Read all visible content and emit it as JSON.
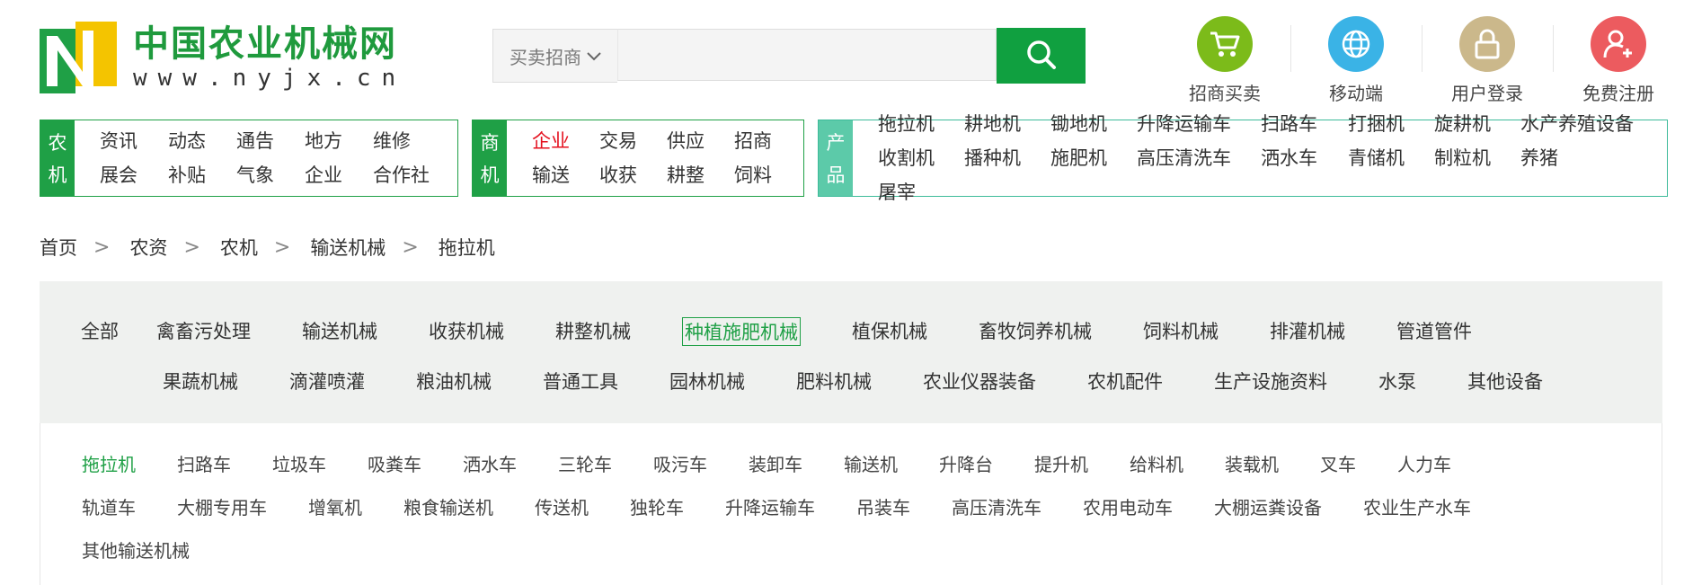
{
  "logo": {
    "name": "中国农业机械网",
    "url": "www.nyjx.cn"
  },
  "search": {
    "category": "买卖招商",
    "value": "",
    "placeholder": ""
  },
  "shortcuts": [
    {
      "label": "招商买卖",
      "color": "#7cbb1a",
      "icon": "cart-icon"
    },
    {
      "label": "移动端",
      "color": "#3ab3e6",
      "icon": "globe-icon"
    },
    {
      "label": "用户登录",
      "color": "#cbb88b",
      "icon": "lock-icon"
    },
    {
      "label": "免费注册",
      "color": "#ec5b5f",
      "icon": "add-user-icon"
    }
  ],
  "nav": {
    "nongji": {
      "tag": [
        "农",
        "机"
      ],
      "items": [
        "资讯",
        "动态",
        "通告",
        "地方",
        "维修",
        "展会",
        "补贴",
        "气象",
        "企业",
        "合作社"
      ]
    },
    "shangji": {
      "tag": [
        "商",
        "机"
      ],
      "items": [
        "企业",
        "交易",
        "供应",
        "招商",
        "输送",
        "收获",
        "耕整",
        "饲料"
      ]
    },
    "chanpin": {
      "tag": [
        "产",
        "品"
      ],
      "items": [
        "拖拉机",
        "耕地机",
        "锄地机",
        "升降运输车",
        "扫路车",
        "打捆机",
        "旋耕机",
        "水产养殖设备",
        "收割机",
        "播种机",
        "施肥机",
        "高压清洗车",
        "洒水车",
        "青储机",
        "制粒机",
        "养猪",
        "屠宰"
      ]
    }
  },
  "breadcrumb": [
    "首页",
    "农资",
    "农机",
    "输送机械",
    "拖拉机"
  ],
  "categories": {
    "all": "全部",
    "row1": [
      "禽畜污处理",
      "输送机械",
      "收获机械",
      "耕整机械",
      "种植施肥机械",
      "植保机械",
      "畜牧饲养机械",
      "饲料机械",
      "排灌机械",
      "管道管件"
    ],
    "row2": [
      "果蔬机械",
      "滴灌喷灌",
      "粮油机械",
      "普通工具",
      "园林机械",
      "肥料机械",
      "农业仪器装备",
      "农机配件",
      "生产设施资料",
      "水泵",
      "其他设备"
    ],
    "active": "种植施肥机械"
  },
  "subcategories": {
    "row1": [
      "拖拉机",
      "扫路车",
      "垃圾车",
      "吸粪车",
      "洒水车",
      "三轮车",
      "吸污车",
      "装卸车",
      "输送机",
      "升降台",
      "提升机",
      "给料机",
      "装载机",
      "叉车",
      "人力车"
    ],
    "row2": [
      "轨道车",
      "大棚专用车",
      "增氧机",
      "粮食输送机",
      "传送机",
      "独轮车",
      "升降运输车",
      "吊装车",
      "高压清洗车",
      "农用电动车",
      "大棚运粪设备",
      "农业生产水车"
    ],
    "row3": [
      "其他输送机械"
    ],
    "active": "拖拉机"
  }
}
